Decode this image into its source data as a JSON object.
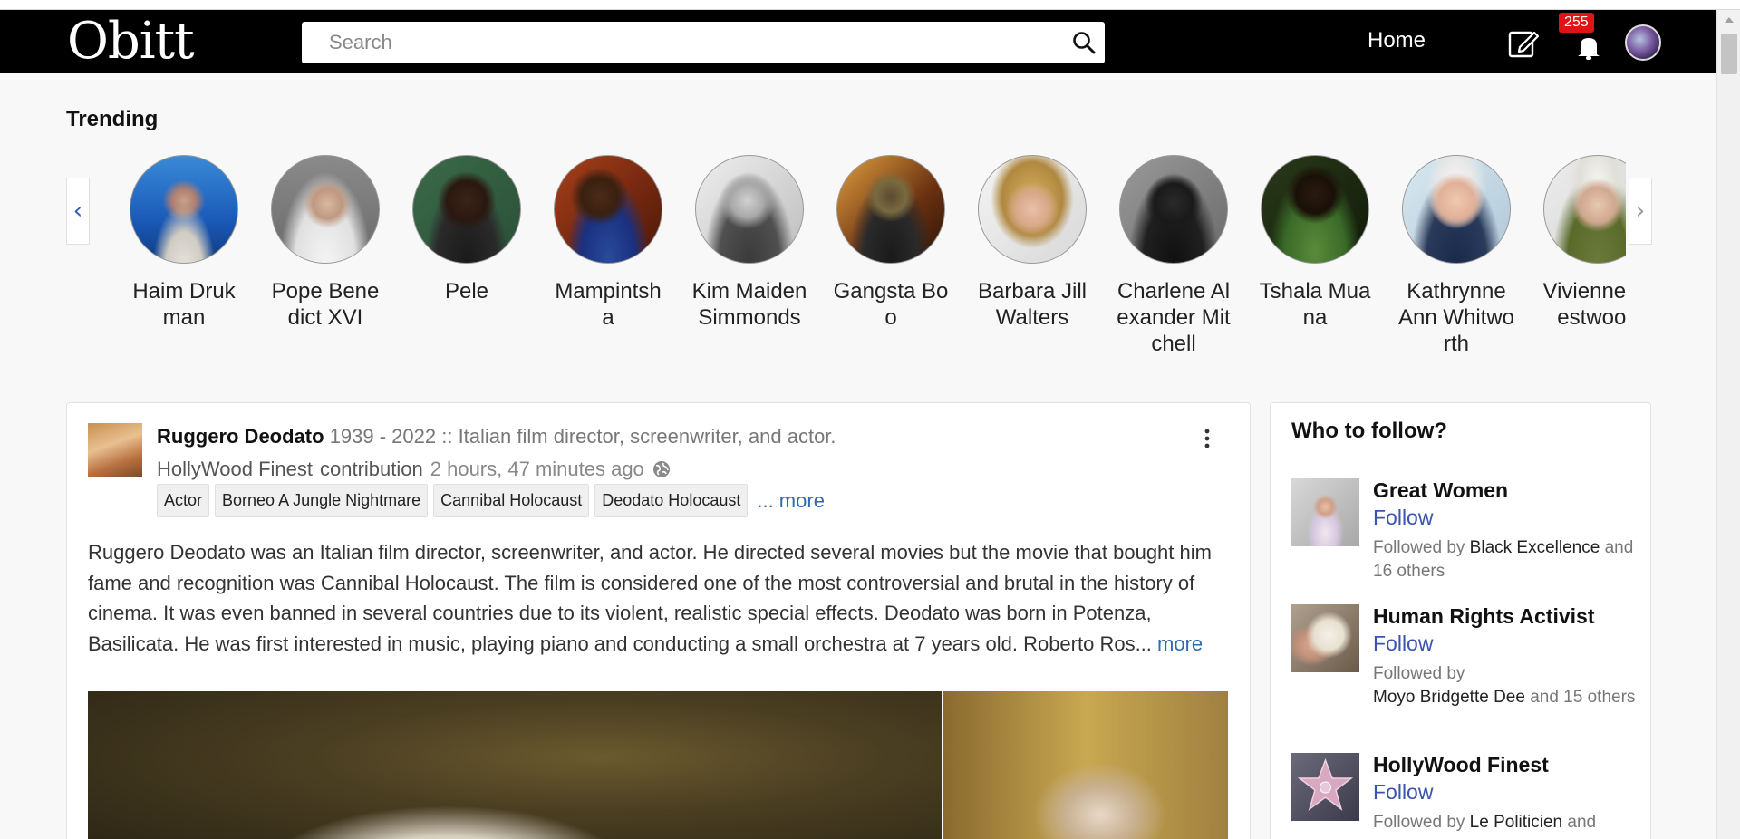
{
  "app": {
    "logo": "Obitt",
    "search_placeholder": "Search",
    "home_label": "Home",
    "notification_count": "255"
  },
  "trending": {
    "title": "Trending",
    "prev_arrow": "‹",
    "next_arrow": "›",
    "people": [
      {
        "name": "Haim Drukman"
      },
      {
        "name": "Pope Benedict XVI"
      },
      {
        "name": "Pele"
      },
      {
        "name": "Mampintsha"
      },
      {
        "name": "Kim Maiden Simmonds"
      },
      {
        "name": "Gangsta Boo"
      },
      {
        "name": "Barbara Jill Walters"
      },
      {
        "name": "Charlene Alexander Mitchell"
      },
      {
        "name": "Tshala Muana"
      },
      {
        "name": "Kathrynne Ann Whitworth"
      },
      {
        "name": "Vivienne Westwood"
      }
    ]
  },
  "post": {
    "author": "Ruggero Deodato",
    "description": "1939 - 2022 :: Italian film director, screenwriter, and actor.",
    "contributor": "HollyWood Finest",
    "contribution_label": "contribution",
    "time_ago": "2 hours, 47 minutes ago",
    "tags": [
      "Actor",
      "Borneo A Jungle Nightmare",
      "Cannibal Holocaust",
      "Deodato Holocaust"
    ],
    "tags_more": "... more",
    "body": "Ruggero Deodato was an Italian film director, screenwriter, and actor. He directed several movies but the movie that bought him fame and recognition was Cannibal Holocaust. The film is considered one of the most controversial and brutal in the history of cinema. It was even banned in several countries due to its violent, realistic special effects. Deodato was born in Potenza, Basilicata. He was first interested in music, playing piano and conducting a small orchestra at 7 years old. Roberto Ros...",
    "body_more": "more"
  },
  "who_to_follow": {
    "title": "Who to follow?",
    "follow_label": "Follow",
    "followed_by_label": "Followed by",
    "items": [
      {
        "name": "Great Women",
        "followed_by": "Black Excellence",
        "others": "and 16 others"
      },
      {
        "name": "Human Rights Activist",
        "followed_by": "Moyo Bridgette Dee",
        "others": "and 15 others"
      },
      {
        "name": "HollyWood Finest",
        "followed_by": "Le Politicien",
        "others": "and"
      }
    ]
  },
  "colors": {
    "header_bg": "#000000",
    "link_blue": "#2d6ab0",
    "follow_blue": "#3a54b0",
    "badge_red": "#e01414"
  },
  "icons": [
    "search-icon",
    "compose-icon",
    "bell-icon",
    "globe-icon",
    "kebab-icon"
  ]
}
